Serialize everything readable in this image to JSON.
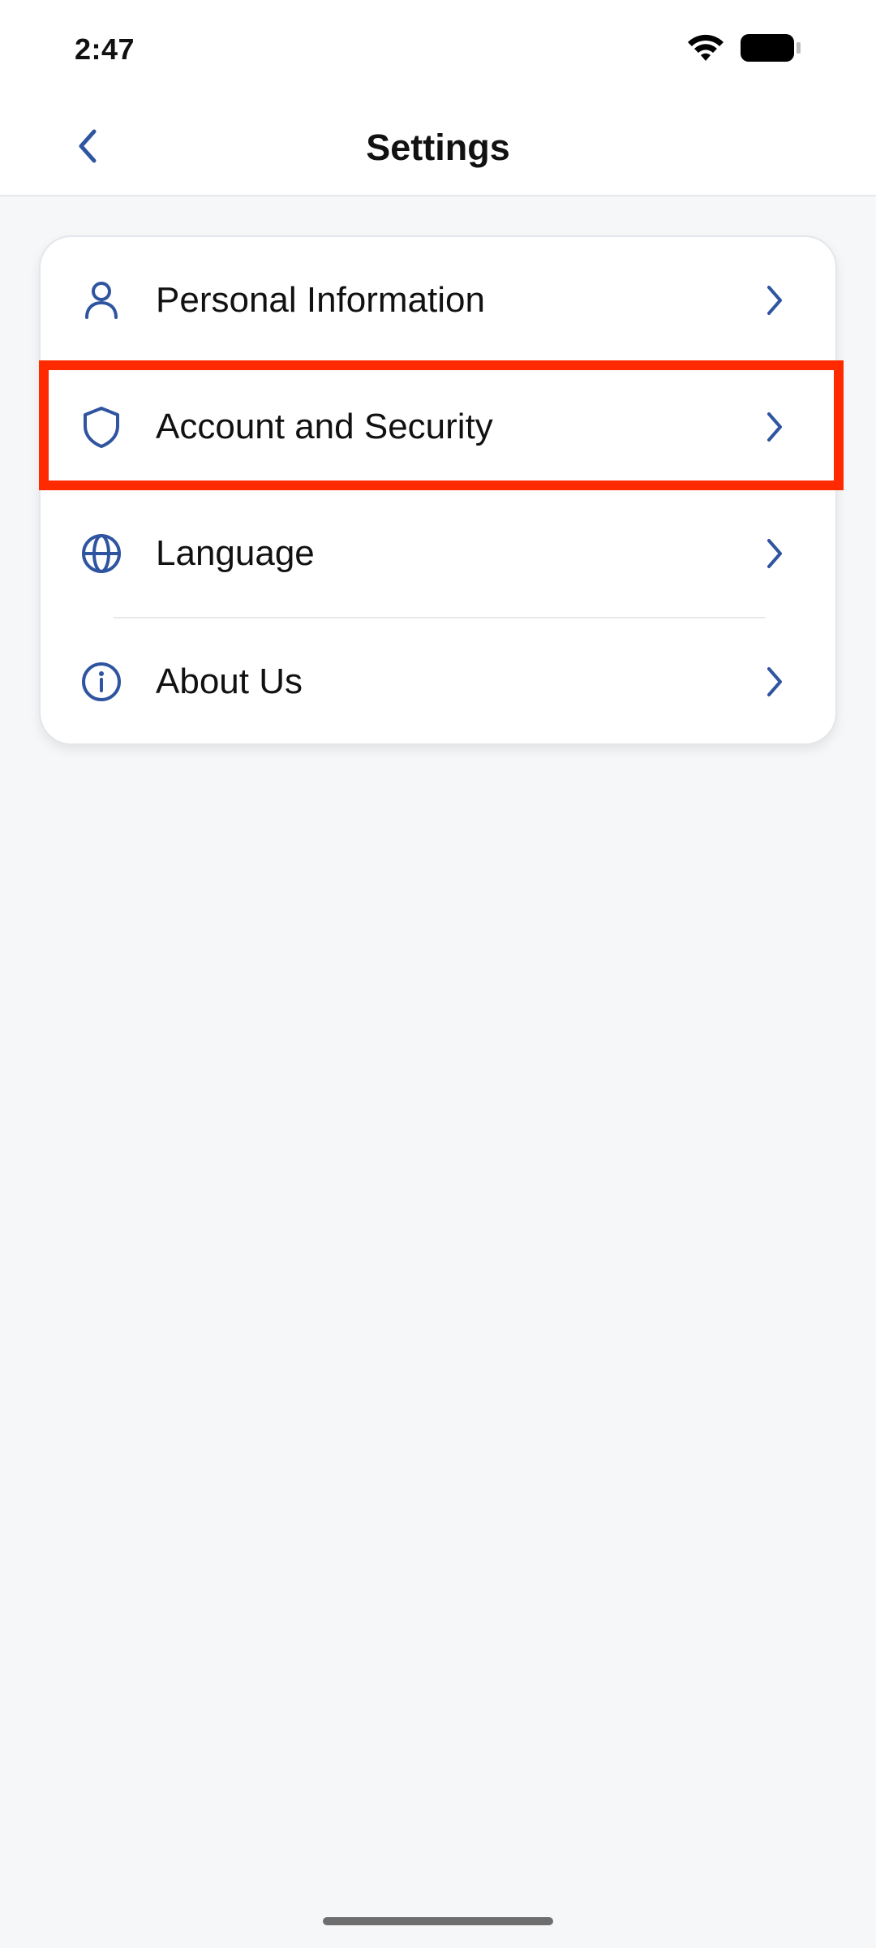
{
  "status_bar": {
    "time": "2:47"
  },
  "header": {
    "title": "Settings"
  },
  "settings_items": [
    {
      "label": "Personal Information",
      "icon": "person-icon"
    },
    {
      "label": "Account and Security",
      "icon": "shield-icon"
    },
    {
      "label": "Language",
      "icon": "globe-icon"
    },
    {
      "label": "About Us",
      "icon": "info-icon"
    }
  ],
  "colors": {
    "accent": "#2f55a0",
    "highlight": "#ff2a00",
    "background": "#f6f7f9"
  }
}
